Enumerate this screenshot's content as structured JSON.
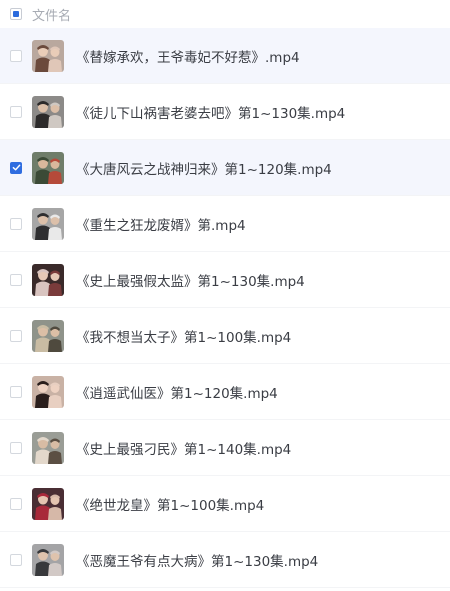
{
  "header": {
    "name_column_label": "文件名",
    "select_all_state": "partial"
  },
  "files": [
    {
      "name": "《替嫁承欢，王爷毒妃不好惹》.mp4",
      "checked": false,
      "highlighted": true,
      "thumb": {
        "bg": "#b9a89e",
        "fig": "#6b4a3c",
        "fig2": "#e0c7b8",
        "skin": "#e9cdb8"
      }
    },
    {
      "name": "《徒儿下山祸害老婆去吧》第1~130集.mp4",
      "checked": false,
      "highlighted": false,
      "thumb": {
        "bg": "#8c8a88",
        "fig": "#2c2a2a",
        "fig2": "#cfc8c2",
        "skin": "#dcbfa8"
      }
    },
    {
      "name": "《大唐风云之战神归来》第1~120集.mp4",
      "checked": true,
      "highlighted": true,
      "thumb": {
        "bg": "#6f7d6a",
        "fig": "#3b4a36",
        "fig2": "#b54a3a",
        "skin": "#d9b89c"
      }
    },
    {
      "name": "《重生之狂龙废婿》第.mp4",
      "checked": false,
      "highlighted": false,
      "thumb": {
        "bg": "#a6a6a6",
        "fig": "#2e2e30",
        "fig2": "#e9e9e9",
        "skin": "#dcc0aa"
      }
    },
    {
      "name": "《史上最强假太监》第1~130集.mp4",
      "checked": false,
      "highlighted": false,
      "thumb": {
        "bg": "#3a2a2a",
        "fig": "#d9c4c0",
        "fig2": "#7a3b3b",
        "skin": "#e6c8b6"
      }
    },
    {
      "name": "《我不想当太子》第1~100集.mp4",
      "checked": false,
      "highlighted": false,
      "thumb": {
        "bg": "#8f938a",
        "fig": "#c9bca3",
        "fig2": "#4f4a3e",
        "skin": "#dcbfa6"
      }
    },
    {
      "name": "《逍遥武仙医》第1~120集.mp4",
      "checked": false,
      "highlighted": false,
      "thumb": {
        "bg": "#c9b2a5",
        "fig": "#2a1e1c",
        "fig2": "#e8cfc1",
        "skin": "#eed2c2"
      }
    },
    {
      "name": "《史上最强刁民》第1~140集.mp4",
      "checked": false,
      "highlighted": false,
      "thumb": {
        "bg": "#9a9d96",
        "fig": "#e3d8cb",
        "fig2": "#5b4f43",
        "skin": "#d8bca4"
      }
    },
    {
      "name": "《绝世龙皇》第1~100集.mp4",
      "checked": false,
      "highlighted": false,
      "thumb": {
        "bg": "#4a2e34",
        "fig": "#a8293a",
        "fig2": "#d6b8a8",
        "skin": "#e4c4b0"
      }
    },
    {
      "name": "《恶魔王爷有点大病》第1~130集.mp4",
      "checked": false,
      "highlighted": false,
      "thumb": {
        "bg": "#a4a4a6",
        "fig": "#38393c",
        "fig2": "#d2c9c6",
        "skin": "#dfc3ad"
      }
    }
  ]
}
